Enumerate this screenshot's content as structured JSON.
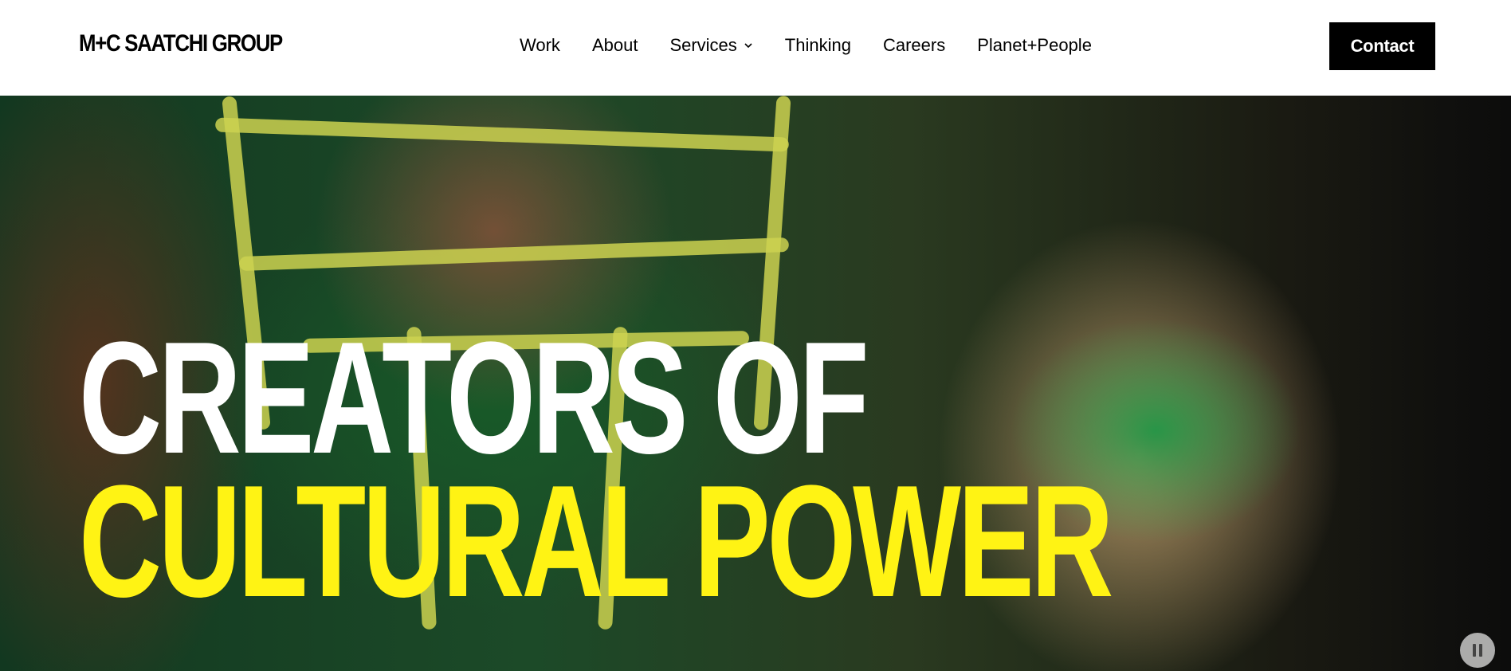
{
  "header": {
    "logo": "M+C SAATCHI GROUP",
    "nav": [
      {
        "label": "Work"
      },
      {
        "label": "About"
      },
      {
        "label": "Services"
      },
      {
        "label": "Thinking"
      },
      {
        "label": "Careers"
      },
      {
        "label": "Planet+People"
      }
    ],
    "contact_label": "Contact"
  },
  "hero": {
    "line1": "CREATORS OF",
    "line2": "CULTURAL POWER",
    "line1_color": "#ffffff",
    "line2_color": "#fff314",
    "pause_icon": "pause-icon"
  }
}
